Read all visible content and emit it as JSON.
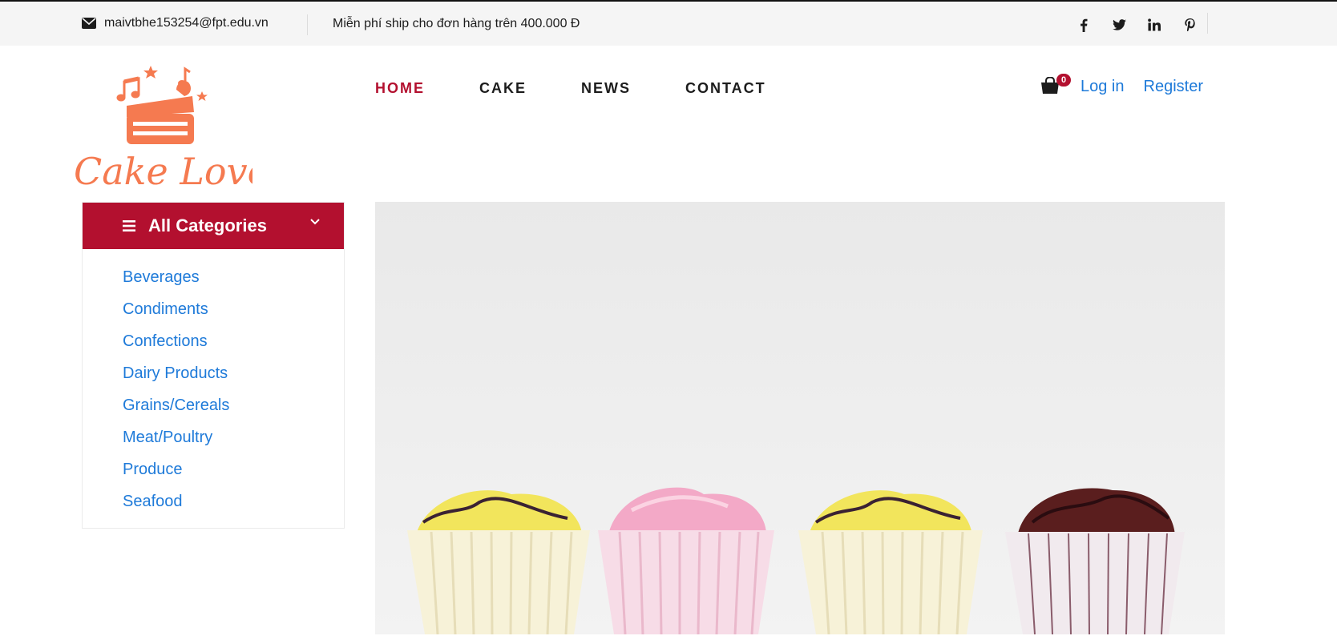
{
  "topbar": {
    "email": "maivtbhe153254@fpt.edu.vn",
    "shipping_note": "Miễn phí ship cho đơn hàng trên 400.000 Đ",
    "social": [
      "facebook-icon",
      "twitter-icon",
      "linkedin-icon",
      "pinterest-icon"
    ]
  },
  "brand": {
    "logo_text": "Cake Lover",
    "color": "#f57a50"
  },
  "nav": {
    "items": [
      {
        "label": "HOME",
        "active": true
      },
      {
        "label": "CAKE",
        "active": false
      },
      {
        "label": "NEWS",
        "active": false
      },
      {
        "label": "CONTACT",
        "active": false
      }
    ]
  },
  "account": {
    "cart_count": "0",
    "login_label": "Log in",
    "register_label": "Register"
  },
  "categories": {
    "title": "All Categories",
    "items": [
      "Beverages",
      "Condiments",
      "Confections",
      "Dairy Products",
      "Grains/Cereals",
      "Meat/Poultry",
      "Produce",
      "Seafood"
    ]
  },
  "colors": {
    "accent": "#b3102f",
    "link": "#1e7ad9"
  }
}
